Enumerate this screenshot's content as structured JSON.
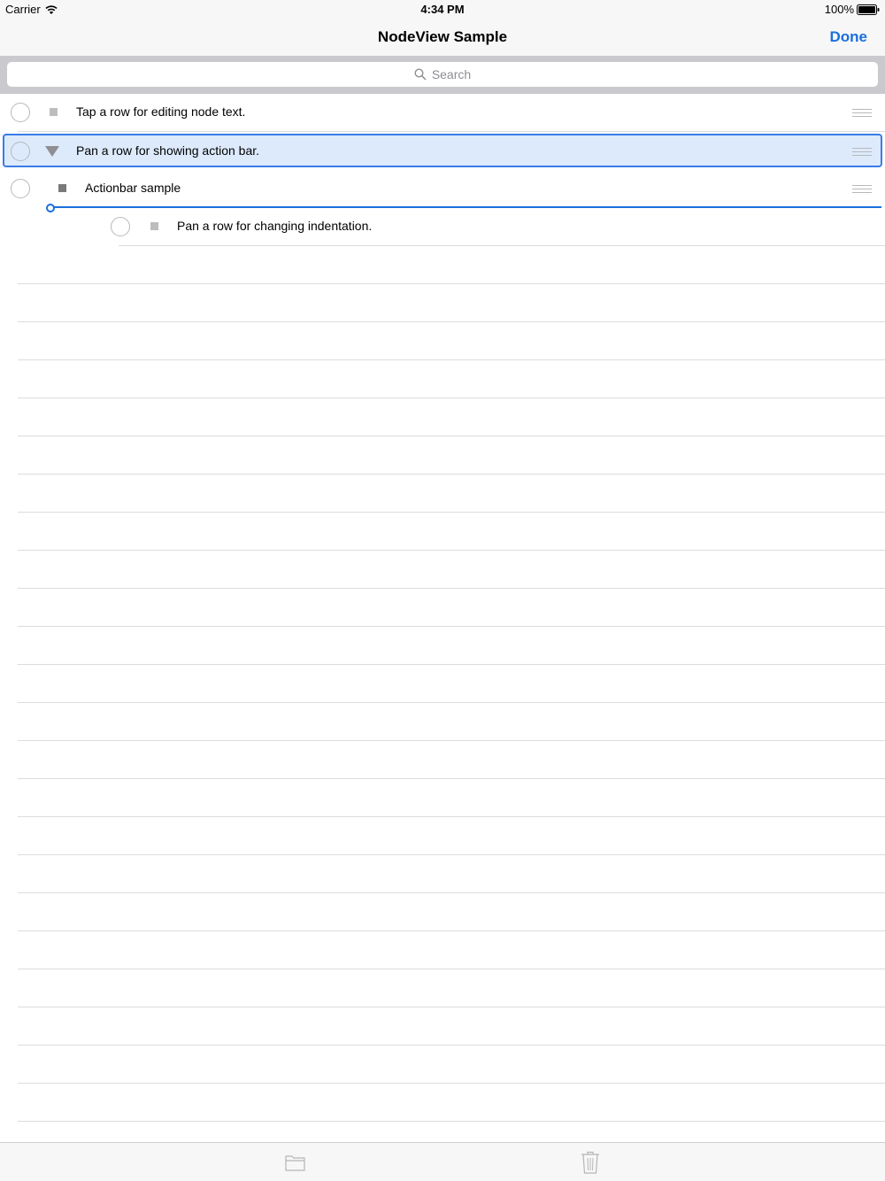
{
  "status_bar": {
    "carrier": "Carrier",
    "time": "4:34 PM",
    "battery": "100%"
  },
  "nav": {
    "title": "NodeView Sample",
    "done_label": "Done"
  },
  "search": {
    "placeholder": "Search"
  },
  "rows": [
    {
      "text": "Tap a row for editing node text.",
      "marker": "square",
      "selected": false
    },
    {
      "text": "Pan a row for showing action bar.",
      "marker": "triangle",
      "selected": true
    },
    {
      "text": "Actionbar sample",
      "marker": "square",
      "selected": false
    },
    {
      "text": "Pan a row for changing indentation.",
      "marker": "square",
      "selected": false
    }
  ],
  "colors": {
    "accent": "#1a6fdc",
    "selection_bg": "#dceafc",
    "selection_border": "#3b7be8"
  },
  "toolbar": {
    "items": [
      "folder-icon",
      "trash-icon"
    ]
  }
}
